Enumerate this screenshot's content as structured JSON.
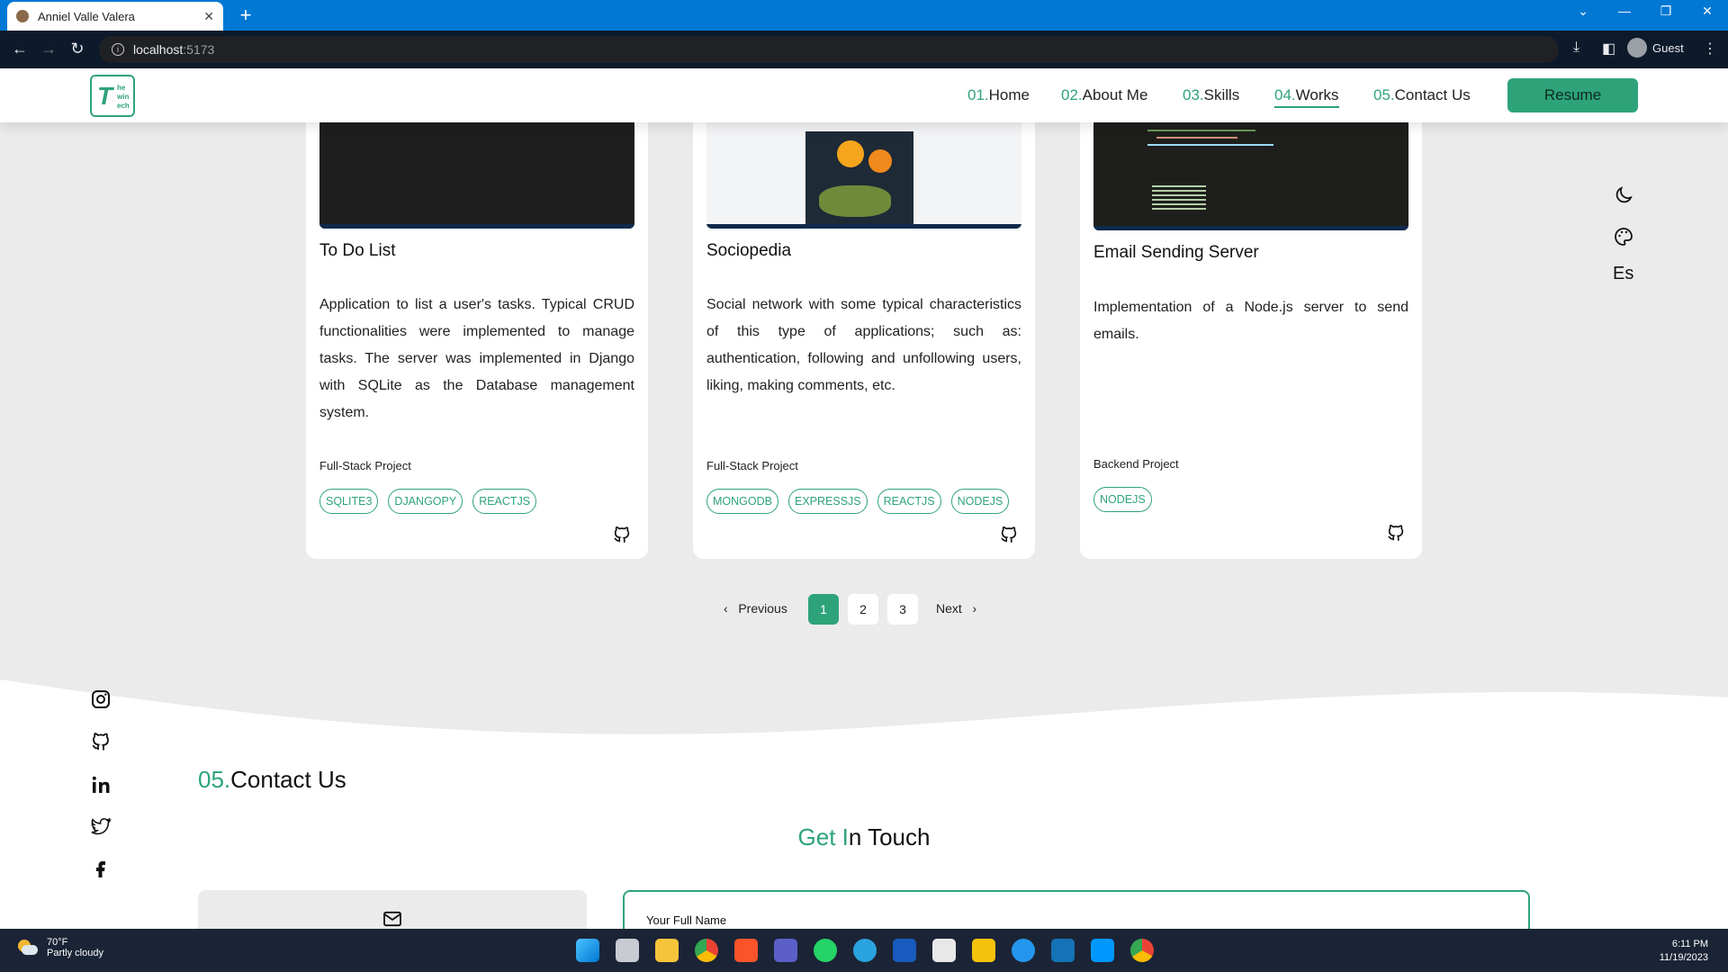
{
  "browser": {
    "tab_title": "Anniel Valle Valera",
    "url_host": "localhost",
    "url_port": ":5173",
    "profile": "Guest"
  },
  "nav": {
    "links": [
      {
        "num": "01.",
        "label": "Home"
      },
      {
        "num": "02.",
        "label": "About Me"
      },
      {
        "num": "03.",
        "label": "Skills"
      },
      {
        "num": "04.",
        "label": "Works"
      },
      {
        "num": "05.",
        "label": "Contact Us"
      }
    ],
    "active": "Works",
    "resume": "Resume"
  },
  "logo": {
    "big": "T",
    "small": "he win ech"
  },
  "side_tools": {
    "theme_icon": "moon-icon",
    "palette_icon": "palette-icon",
    "language": "Es"
  },
  "projects": [
    {
      "title": "To Do List",
      "desc": "Application to list a user's tasks. Typical CRUD functionalities were implemented to manage tasks. The server was implemented in Django with SQLite as the Database management system.",
      "type": "Full-Stack Project",
      "tags": [
        "SQLITE3",
        "DJANGOPY",
        "REACTJS"
      ]
    },
    {
      "title": "Sociopedia",
      "desc": "Social network with some typical characteristics of this type of applications; such as: authentication, following and unfollowing users, liking, making comments, etc.",
      "type": "Full-Stack Project",
      "tags": [
        "MONGODB",
        "EXPRESSJS",
        "REACTJS",
        "NODEJS"
      ]
    },
    {
      "title": "Email Sending Server",
      "desc": "Implementation of a Node.js server to send emails.",
      "type": "Backend Project",
      "tags": [
        "NODEJS"
      ]
    }
  ],
  "pagination": {
    "previous": "Previous",
    "next": "Next",
    "pages": [
      "1",
      "2",
      "3"
    ],
    "current": "1"
  },
  "contact": {
    "num": "05.",
    "title": "Contact Us",
    "get_g": "Get I",
    "get_rest": "n Touch",
    "field_label": "Your Full Name"
  },
  "social_icons": [
    "instagram-icon",
    "github-icon",
    "linkedin-icon",
    "twitter-icon",
    "facebook-icon"
  ],
  "taskbar": {
    "temp": "70°F",
    "weather": "Partly cloudy",
    "time": "6:11 PM",
    "date": "11/19/2023"
  },
  "colors": {
    "accent": "#2ea37a",
    "browser_blue": "#0078d4"
  }
}
